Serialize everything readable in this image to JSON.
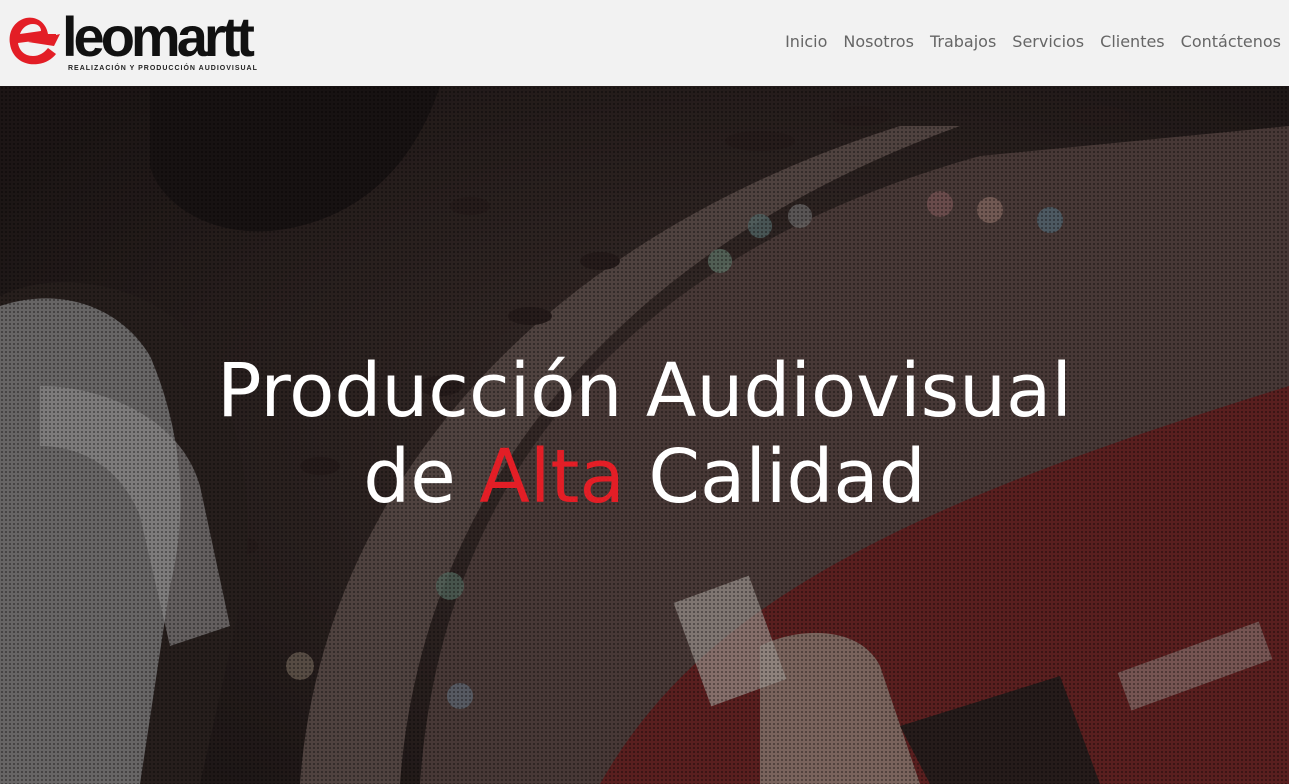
{
  "brand": {
    "name": "leomartt",
    "tagline": "REALIZACIÓN Y PRODUCCIÓN AUDIOVISUAL",
    "accent_color": "#e31e26",
    "mark_icon": "e-letter-logo-icon"
  },
  "nav": {
    "items": [
      "Inicio",
      "Nosotros",
      "Trabajos",
      "Servicios",
      "Clientes",
      "Contáctenos"
    ]
  },
  "hero": {
    "title_line1": "Producción Audiovisual",
    "title_line2_prefix": "de",
    "title_line2_accent": "Alta",
    "title_line2_suffix": "Calidad",
    "background": "casino-table-photo"
  }
}
